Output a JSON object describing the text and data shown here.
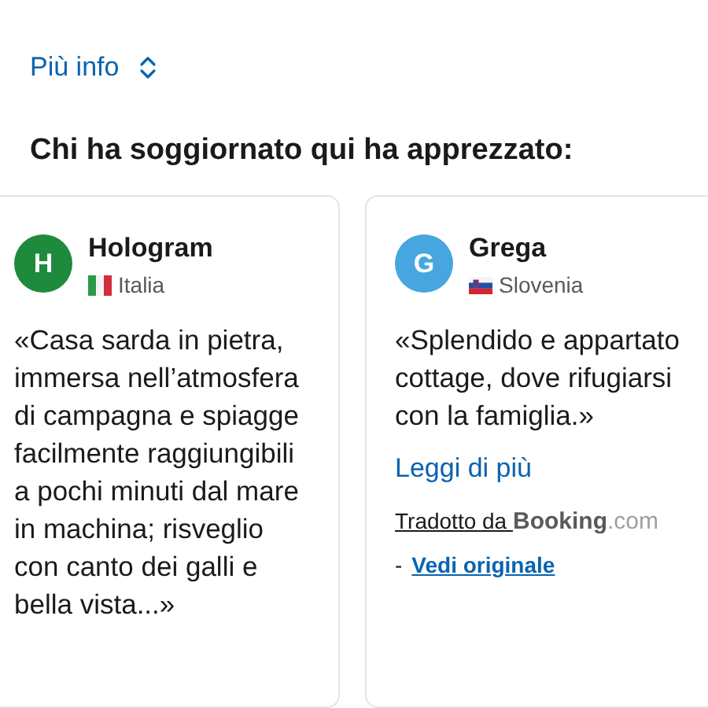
{
  "more_info": {
    "label": "Più info"
  },
  "heading": "Chi ha soggiornato qui ha apprezzato:",
  "reviews": [
    {
      "initial": "H",
      "color": "#1e8a3c",
      "name": "Hologram",
      "flag": {
        "kind": "italy"
      },
      "country": "Italia",
      "quote": "«Casa sarda in pietra, immersa nell’atmosfera di campagna e spiagge facilmente raggiungibili a pochi minuti dal mare in machina; risveglio con canto dei galli e bella vista...»"
    },
    {
      "initial": "G",
      "color": "#47a6df",
      "name": "Grega",
      "flag": {
        "kind": "slovenia"
      },
      "country": "Slovenia",
      "quote": "«Splendido e appartato cottage, dove rifugiarsi con la famiglia.»",
      "read_more": "Leggi di più",
      "translated_by": "Tradotto da ",
      "logo_main": "Booking",
      "logo_suffix": ".com",
      "dash": "-",
      "see_original": "Vedi originale"
    }
  ]
}
